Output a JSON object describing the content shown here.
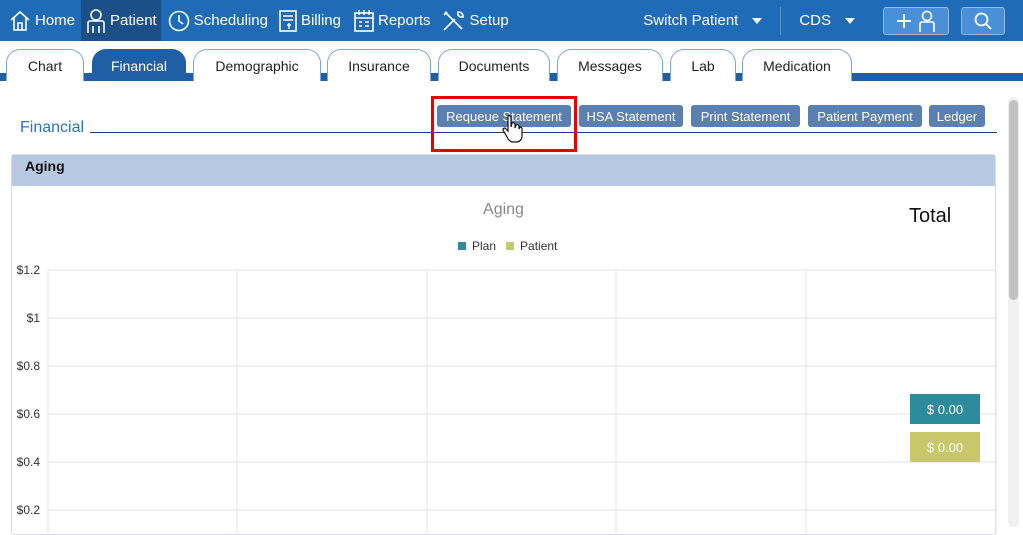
{
  "nav": {
    "items": [
      {
        "label": "Home",
        "icon": "home-icon"
      },
      {
        "label": "Patient",
        "icon": "person-icon",
        "active": true
      },
      {
        "label": "Scheduling",
        "icon": "clock-icon"
      },
      {
        "label": "Billing",
        "icon": "billing-icon"
      },
      {
        "label": "Reports",
        "icon": "calendar-icon"
      },
      {
        "label": "Setup",
        "icon": "tools-icon"
      }
    ],
    "switch_patient": "Switch Patient",
    "cds": "CDS",
    "add_patient_icon": "add-person-icon",
    "search_icon": "search-icon"
  },
  "tabs": [
    {
      "label": "Chart"
    },
    {
      "label": "Financial",
      "active": true
    },
    {
      "label": "Demographic"
    },
    {
      "label": "Insurance"
    },
    {
      "label": "Documents"
    },
    {
      "label": "Messages"
    },
    {
      "label": "Lab"
    },
    {
      "label": "Medication"
    }
  ],
  "financial": {
    "title": "Financial",
    "buttons": {
      "requeue": "Requeue Statement",
      "hsa": "HSA Statement",
      "print": "Print Statement",
      "payment": "Patient Payment",
      "ledger": "Ledger"
    }
  },
  "aging": {
    "header": "Aging",
    "total_label": "Total",
    "plan_total": "$ 0.00",
    "patient_total": "$ 0.00"
  },
  "colors": {
    "nav_bg": "#1f6bb8",
    "plan": "#2e8b9c",
    "patient": "#c8c86a",
    "highlight": "#e60000"
  },
  "chart_data": {
    "type": "bar",
    "title": "Aging",
    "series": [
      {
        "name": "Plan",
        "values": []
      },
      {
        "name": "Patient",
        "values": []
      }
    ],
    "categories": [],
    "y_ticks": [
      "$1.2",
      "$1",
      "$0.8",
      "$0.6",
      "$0.4",
      "$0.2"
    ],
    "ylim": [
      0,
      1.2
    ],
    "grid": true,
    "legend": "top-center"
  }
}
